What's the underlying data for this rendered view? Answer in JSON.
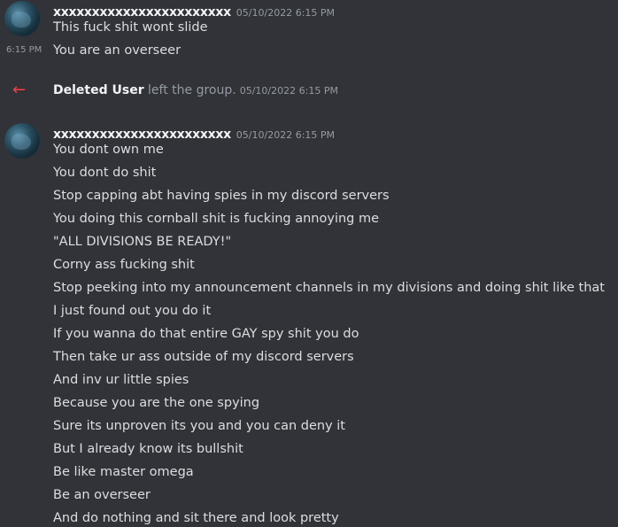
{
  "messages": [
    {
      "username": "xxxxxxxxxxxxxxxxxxxxxxx",
      "timestamp": "05/10/2022 6:15 PM",
      "lines": [
        "This fuck shit wont slide",
        "You are an overseer"
      ],
      "side_timestamp": "6:15 PM"
    },
    {
      "username": "xxxxxxxxxxxxxxxxxxxxxxx",
      "timestamp": "05/10/2022 6:15 PM",
      "lines": [
        "You dont own me",
        "You dont do shit",
        "Stop capping abt having spies in my discord servers",
        "You doing this cornball shit is fucking annoying me",
        "\"ALL DIVISIONS BE READY!\"",
        "Corny ass fucking shit",
        "Stop peeking into my announcement channels in my divisions and doing shit like that",
        "I just found out you do it",
        "If you wanna do that entire GAY spy shit you do",
        "Then take ur ass outside of my discord servers",
        "And inv ur little spies",
        "Because you are the one spying",
        "Sure its unproven its you and you can deny it",
        "But I already know its bullshit",
        "Be like master omega",
        "Be an overseer",
        "And do nothing and sit there and look pretty"
      ]
    }
  ],
  "system": {
    "user": "Deleted User",
    "action": " left the group.",
    "timestamp": "05/10/2022 6:15 PM",
    "icon": "leave-arrow-icon"
  }
}
